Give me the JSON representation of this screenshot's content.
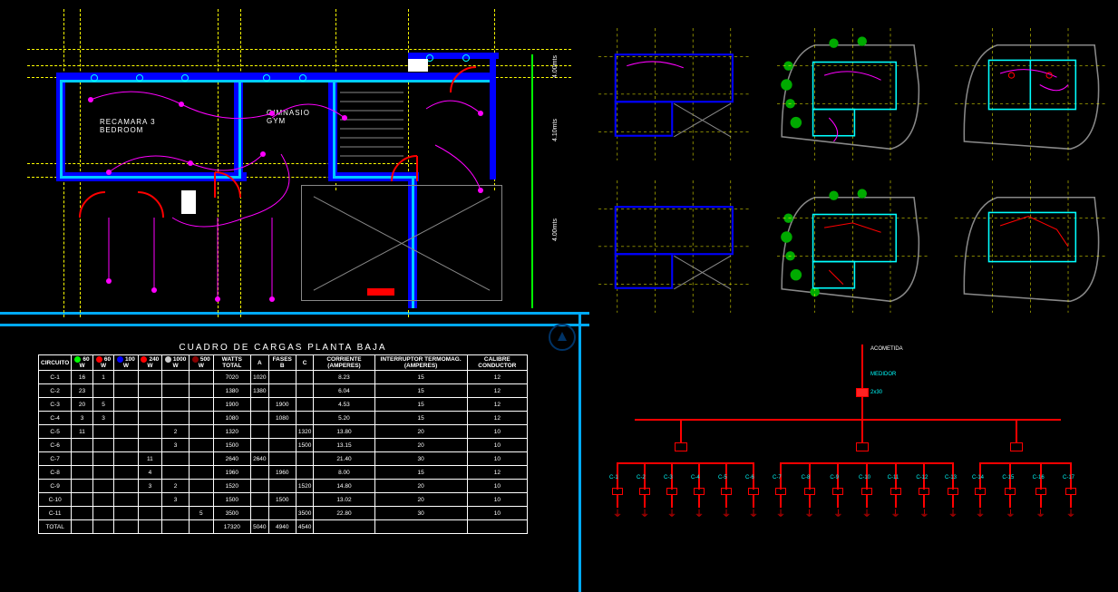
{
  "floorplan": {
    "rooms": {
      "bedroom": "RECAMARA 3\nBEDROOM",
      "gym": "GIMNASIO\nGYM"
    },
    "dims": {
      "h1": "4.00mts",
      "h2": "4.10mts",
      "h3": "4.00mts"
    }
  },
  "table": {
    "title": "CUADRO DE CARGAS   PLANTA BAJA",
    "columns": [
      "CIRCUITO",
      "60 W",
      "60 W",
      "100 W",
      "240 W",
      "1000 W",
      "500 W",
      "WATTS TOTAL",
      "A",
      "FASES B",
      "C",
      "CORRIENTE (AMPERES)",
      "INTERRUPTOR TERMOMAG. (AMPERES)",
      "CALIBRE CONDUCTOR"
    ],
    "header_colors": [
      "",
      "#0f0",
      "#f00",
      "#00f",
      "#f00",
      "#ccc",
      "#800",
      "",
      "",
      "",
      "",
      "",
      "",
      ""
    ],
    "rows": [
      [
        "C-1",
        "16",
        "1",
        "",
        "",
        "",
        "",
        "7020",
        "1020",
        "",
        "",
        "8.23",
        "15",
        "12"
      ],
      [
        "C-2",
        "23",
        "",
        "",
        "",
        "",
        "",
        "1380",
        "1380",
        "",
        "",
        "6.04",
        "15",
        "12"
      ],
      [
        "C-3",
        "20",
        "5",
        "",
        "",
        "",
        "",
        "1900",
        "",
        "1900",
        "",
        "4.53",
        "15",
        "12"
      ],
      [
        "C-4",
        "3",
        "3",
        "",
        "",
        "",
        "",
        "1080",
        "",
        "1080",
        "",
        "5.20",
        "15",
        "12"
      ],
      [
        "C-5",
        "11",
        "",
        "",
        "",
        "2",
        "",
        "1320",
        "",
        "",
        "1320",
        "13.80",
        "20",
        "10"
      ],
      [
        "C-6",
        "",
        "",
        "",
        "",
        "3",
        "",
        "1500",
        "",
        "",
        "1500",
        "13.15",
        "20",
        "10"
      ],
      [
        "C-7",
        "",
        "",
        "",
        "11",
        "",
        "",
        "2640",
        "2640",
        "",
        "",
        "21.40",
        "30",
        "10"
      ],
      [
        "C-8",
        "",
        "",
        "",
        "4",
        "",
        "",
        "1960",
        "",
        "1960",
        "",
        "8.00",
        "15",
        "12"
      ],
      [
        "C-9",
        "",
        "",
        "",
        "3",
        "2",
        "",
        "1520",
        "",
        "",
        "1520",
        "14.80",
        "20",
        "10"
      ],
      [
        "C-10",
        "",
        "",
        "",
        "",
        "3",
        "",
        "1500",
        "",
        "1500",
        "",
        "13.02",
        "20",
        "10"
      ],
      [
        "C-11",
        "",
        "",
        "",
        "",
        "",
        "5",
        "3500",
        "",
        "",
        "3500",
        "22.80",
        "30",
        "10"
      ],
      [
        "TOTAL",
        "",
        "",
        "",
        "",
        "",
        "",
        "17320",
        "5040",
        "4940",
        "4540",
        "",
        "",
        ""
      ]
    ]
  },
  "sld": {
    "feeders": [
      "C-1",
      "C-2",
      "C-3",
      "C-4",
      "C-5",
      "C-6",
      "C-7",
      "C-8",
      "C-9",
      "C-10",
      "C-11",
      "C-12",
      "C-13",
      "C-14",
      "C-15",
      "C-16",
      "C-17"
    ],
    "supply": "ACOMETIDA",
    "meter": "MEDIDOR",
    "main": "2x30"
  }
}
